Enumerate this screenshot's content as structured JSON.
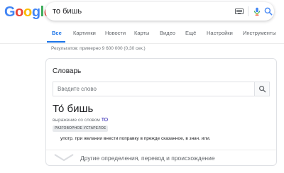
{
  "logo": {
    "letters": [
      "G",
      "o",
      "o",
      "g",
      "l",
      "e"
    ]
  },
  "search": {
    "query": "то бишь"
  },
  "icons": [
    "keyboard-icon",
    "mic-icon",
    "search-icon",
    "chevron-down-icon"
  ],
  "tabs": [
    {
      "label": "Все",
      "active": true
    },
    {
      "label": "Картинки",
      "active": false
    },
    {
      "label": "Новости",
      "active": false
    },
    {
      "label": "Карты",
      "active": false
    },
    {
      "label": "Видео",
      "active": false
    },
    {
      "label": "Ещё",
      "active": false
    },
    {
      "label": "Настройки",
      "active": false
    },
    {
      "label": "Инструменты",
      "active": false
    }
  ],
  "stats": "Результатов: примерно 9 600 000 (0,30 сек.)",
  "dictionary": {
    "title": "Словарь",
    "input_placeholder": "Введите слово",
    "headword": "То́ бишь",
    "subline_text": "выражение со словом",
    "subline_link": "ТО",
    "badge": "РАЗГОВОРНОЕ УСТАРЕЛОЕ",
    "definition": "употр. при желании внести поправку в прежде сказанное, в знач. или.",
    "more_label": "Другие определения, перевод и происхождение"
  },
  "colors": {
    "accent": "#1a73e8",
    "link": "#1a0dab",
    "google_blue": "#4285f4",
    "google_red": "#ea4335",
    "google_yellow": "#fbbc05",
    "google_green": "#34a853"
  }
}
